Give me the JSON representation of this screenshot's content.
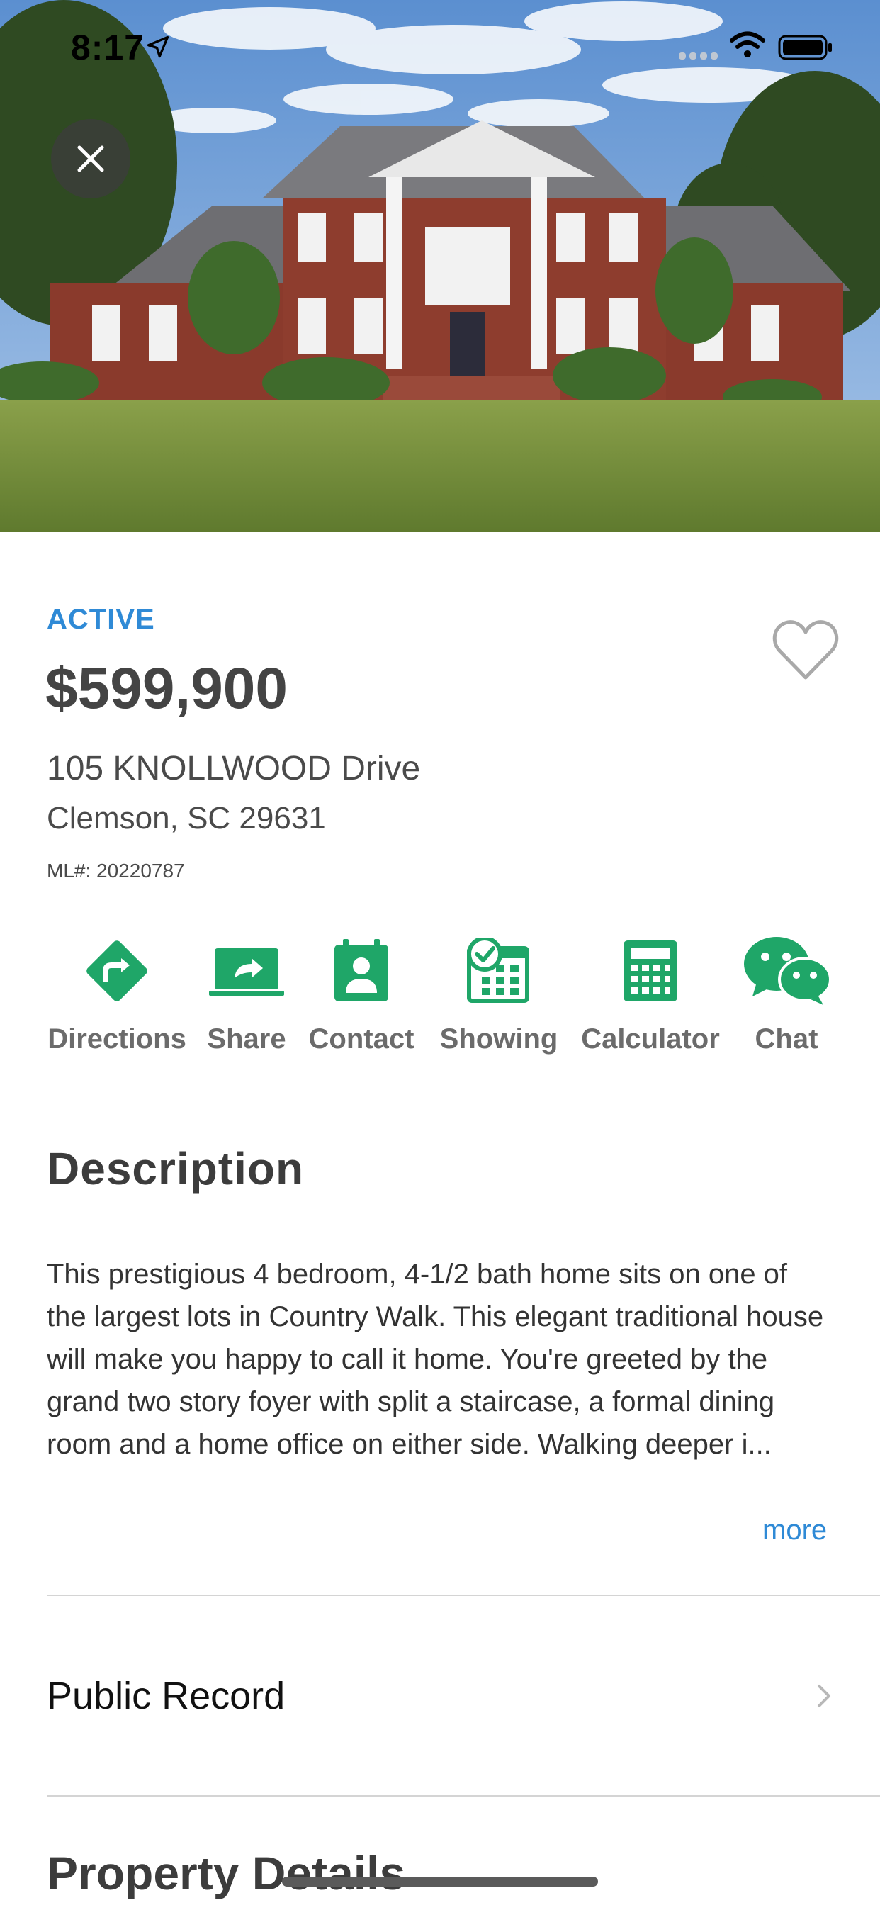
{
  "status_bar": {
    "time": "8:17"
  },
  "listing": {
    "status": "ACTIVE",
    "price": "$599,900",
    "street": "105 KNOLLWOOD Drive",
    "city_state_zip": "Clemson, SC 29631",
    "mls": "ML#: 20220787",
    "favorited": false
  },
  "actions": [
    {
      "label": "Directions",
      "icon": "directions-icon"
    },
    {
      "label": "Share",
      "icon": "share-icon"
    },
    {
      "label": "Contact",
      "icon": "contact-icon"
    },
    {
      "label": "Showing",
      "icon": "calendar-check-icon"
    },
    {
      "label": "Calculator",
      "icon": "calculator-icon"
    },
    {
      "label": "Chat",
      "icon": "chat-icon"
    }
  ],
  "description": {
    "title": "Description",
    "text": "This prestigious 4 bedroom, 4-1/2 bath home sits on one of the largest lots in Country Walk. This elegant traditional house will make you happy to call it home. You're greeted by the grand two story foyer with split a staircase, a formal dining room and a home office on either side. Walking deeper i...",
    "more_label": "more"
  },
  "sections": {
    "public_record": "Public Record",
    "property_details": "Property Details"
  },
  "colors": {
    "accent_green": "#1fa668",
    "status_blue": "#2f8ad6"
  }
}
